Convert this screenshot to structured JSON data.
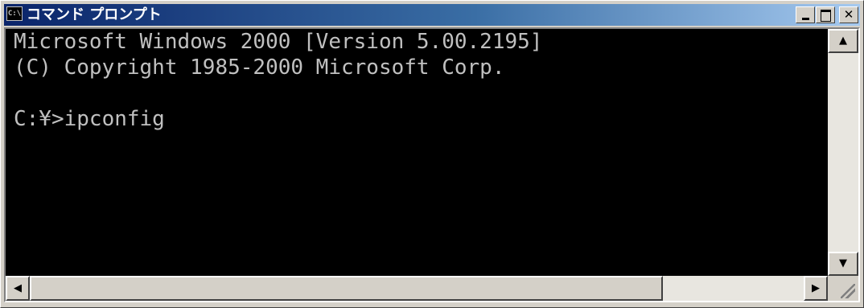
{
  "window": {
    "title": "コマンド プロンプト",
    "icon_text": "C:\\",
    "title_gradient": [
      "#0a246a",
      "#a6caf0"
    ]
  },
  "console": {
    "lines": [
      "Microsoft Windows 2000 [Version 5.00.2195]",
      "(C) Copyright 1985-2000 Microsoft Corp.",
      "",
      "C:¥>ipconfig"
    ],
    "background": "#000000",
    "text_color": "#c0c0c0"
  },
  "controls": {
    "icons": [
      "minimize-icon",
      "maximize-icon",
      "close-icon"
    ],
    "close_glyph": "✕"
  },
  "scrollbars": {
    "up_glyph": "▲",
    "down_glyph": "▼",
    "left_glyph": "◀",
    "right_glyph": "▶"
  }
}
